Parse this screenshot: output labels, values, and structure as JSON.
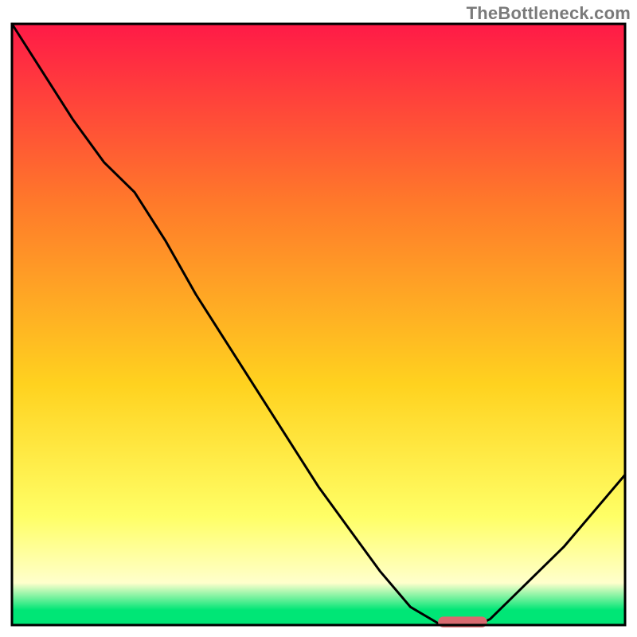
{
  "watermark": "TheBottleneck.com",
  "colors": {
    "gradient_top": "#ff1a47",
    "gradient_upper_mid": "#ff7a2a",
    "gradient_mid": "#ffd21f",
    "gradient_lower_mid": "#ffff66",
    "gradient_pale": "#ffffcc",
    "gradient_green": "#00e676",
    "curve": "#000000",
    "marker_fill": "#d86a6f",
    "frame": "#000000"
  },
  "chart_data": {
    "type": "line",
    "title": "",
    "xlabel": "",
    "ylabel": "",
    "x": [
      0.0,
      0.05,
      0.1,
      0.15,
      0.2,
      0.25,
      0.3,
      0.35,
      0.4,
      0.45,
      0.5,
      0.55,
      0.6,
      0.65,
      0.7,
      0.72,
      0.74,
      0.76,
      0.78,
      0.8,
      0.85,
      0.9,
      0.95,
      1.0
    ],
    "values": [
      1.0,
      0.92,
      0.84,
      0.77,
      0.72,
      0.64,
      0.55,
      0.47,
      0.39,
      0.31,
      0.23,
      0.16,
      0.09,
      0.03,
      0.0,
      0.0,
      0.0,
      0.0,
      0.01,
      0.03,
      0.08,
      0.13,
      0.19,
      0.25
    ],
    "xlim": [
      0,
      1
    ],
    "ylim": [
      0,
      1
    ],
    "marker": {
      "x_center": 0.735,
      "y_center": 0.005,
      "width": 0.08,
      "height": 0.018
    },
    "annotations": []
  }
}
